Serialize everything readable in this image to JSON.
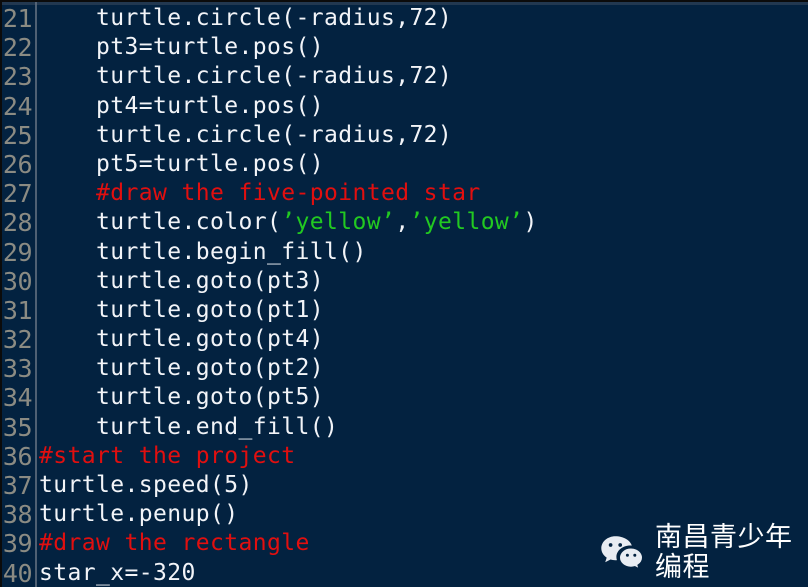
{
  "editor": {
    "background_color": "#032240",
    "gutter_rule_color": "#5d6b7c",
    "line_number_color": "#8b8b83",
    "first_line_number": 21,
    "last_line_number": 40,
    "language": "python"
  },
  "syntax_colors": {
    "plain": "#f2f4f8",
    "comment": "#e10f0f",
    "string": "#22c921"
  },
  "code": [
    {
      "number": "21",
      "indent": "    ",
      "tokens": [
        {
          "type": "plain",
          "text": "turtle.circle(-radius,72)"
        }
      ]
    },
    {
      "number": "22",
      "indent": "    ",
      "tokens": [
        {
          "type": "plain",
          "text": "pt3=turtle.pos()"
        }
      ]
    },
    {
      "number": "23",
      "indent": "    ",
      "tokens": [
        {
          "type": "plain",
          "text": "turtle.circle(-radius,72)"
        }
      ]
    },
    {
      "number": "24",
      "indent": "    ",
      "tokens": [
        {
          "type": "plain",
          "text": "pt4=turtle.pos()"
        }
      ]
    },
    {
      "number": "25",
      "indent": "    ",
      "tokens": [
        {
          "type": "plain",
          "text": "turtle.circle(-radius,72)"
        }
      ]
    },
    {
      "number": "26",
      "indent": "    ",
      "tokens": [
        {
          "type": "plain",
          "text": "pt5=turtle.pos()"
        }
      ]
    },
    {
      "number": "27",
      "indent": "    ",
      "tokens": [
        {
          "type": "comment",
          "text": "#draw the five-pointed star"
        }
      ]
    },
    {
      "number": "28",
      "indent": "    ",
      "tokens": [
        {
          "type": "plain",
          "text": "turtle.color("
        },
        {
          "type": "string",
          "text": "’yellow’"
        },
        {
          "type": "plain",
          "text": ","
        },
        {
          "type": "string",
          "text": "’yellow’"
        },
        {
          "type": "plain",
          "text": ")"
        }
      ]
    },
    {
      "number": "29",
      "indent": "    ",
      "tokens": [
        {
          "type": "plain",
          "text": "turtle.begin_fill()"
        }
      ]
    },
    {
      "number": "30",
      "indent": "    ",
      "tokens": [
        {
          "type": "plain",
          "text": "turtle.goto(pt3)"
        }
      ]
    },
    {
      "number": "31",
      "indent": "    ",
      "tokens": [
        {
          "type": "plain",
          "text": "turtle.goto(pt1)"
        }
      ]
    },
    {
      "number": "32",
      "indent": "    ",
      "tokens": [
        {
          "type": "plain",
          "text": "turtle.goto(pt4)"
        }
      ]
    },
    {
      "number": "33",
      "indent": "    ",
      "tokens": [
        {
          "type": "plain",
          "text": "turtle.goto(pt2)"
        }
      ]
    },
    {
      "number": "34",
      "indent": "    ",
      "tokens": [
        {
          "type": "plain",
          "text": "turtle.goto(pt5)"
        }
      ]
    },
    {
      "number": "35",
      "indent": "    ",
      "tokens": [
        {
          "type": "plain",
          "text": "turtle.end_fill()"
        }
      ]
    },
    {
      "number": "36",
      "indent": "",
      "tokens": [
        {
          "type": "comment",
          "text": "#start the project"
        }
      ]
    },
    {
      "number": "37",
      "indent": "",
      "tokens": [
        {
          "type": "plain",
          "text": "turtle.speed(5)"
        }
      ]
    },
    {
      "number": "38",
      "indent": "",
      "tokens": [
        {
          "type": "plain",
          "text": "turtle.penup()"
        }
      ]
    },
    {
      "number": "39",
      "indent": "",
      "tokens": [
        {
          "type": "comment",
          "text": "#draw the rectangle"
        }
      ]
    },
    {
      "number": "40",
      "indent": "",
      "tokens": [
        {
          "type": "plain",
          "text": "star_x=-320"
        }
      ]
    }
  ],
  "watermark": {
    "icon": "wechat-icon",
    "icon_color": "#e8ecf2",
    "text": "南昌青少年编程",
    "text_color": "#ffffff"
  }
}
